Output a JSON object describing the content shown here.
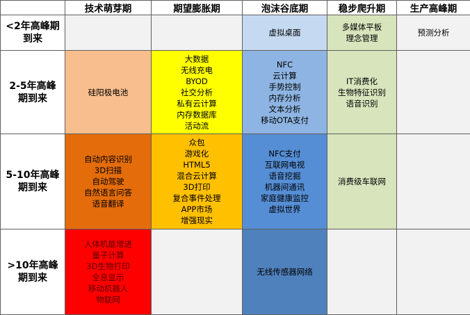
{
  "columns": [
    "技术萌芽期",
    "期望膨胀期",
    "泡沫谷底期",
    "稳步爬升期",
    "生产高峰期"
  ],
  "rows": [
    {
      "label": [
        "<2年高峰期",
        "到来"
      ],
      "cells": [
        [],
        [],
        [
          "虚拟桌面"
        ],
        [
          "多媒体平板",
          "理念管理"
        ],
        [
          "预测分析"
        ]
      ]
    },
    {
      "label": [
        "2-5年高峰",
        "期到来"
      ],
      "cells": [
        [
          "硅阳极电池"
        ],
        [
          "大数据",
          "无线充电",
          "BYOD",
          "社交分析",
          "私有云计算",
          "内存数据库",
          "活动流"
        ],
        [
          "NFC",
          "云计算",
          "手势控制",
          "内存分析",
          "文本分析",
          "移动OTA支付"
        ],
        [
          "IT消费化",
          "生物特征识别",
          "语音识别"
        ],
        []
      ]
    },
    {
      "label": [
        "5-10年高峰",
        "期到来"
      ],
      "cells": [
        [
          "自动内容识别",
          "3D扫描",
          "自动驾驶",
          "自然语言问答",
          "语音翻译"
        ],
        [
          "众包",
          "游戏化",
          "HTML5",
          "混合云计算",
          "3D打印",
          "复合事件处理",
          "APP市场",
          "增强现实"
        ],
        [
          "NFC支付",
          "互联网电视",
          "语音挖掘",
          "机器间通讯",
          "家庭健康监控",
          "虚拟世界"
        ],
        [
          "消费级车联网"
        ],
        []
      ]
    },
    {
      "label": [
        ">10年高峰",
        "期到来"
      ],
      "cells": [
        [
          "人体机能增进",
          "量子计算",
          "3D生物打印",
          "全息显示",
          "移动机器人",
          "物联网"
        ],
        [],
        [
          "无线传感器网络"
        ],
        [],
        []
      ]
    }
  ],
  "colors": {
    "empty": "#f2f2f2",
    "peach": "#f8be8e",
    "yellow": "#ffff00",
    "light_blue": "#c5d9f1",
    "blue": "#8db4e2",
    "mid_blue": "#558ed5",
    "dark_blue": "#4f81bd",
    "orange": "#e46c0a",
    "gold": "#ffc000",
    "green": "#d7e4bc",
    "red": "#ff0000"
  }
}
